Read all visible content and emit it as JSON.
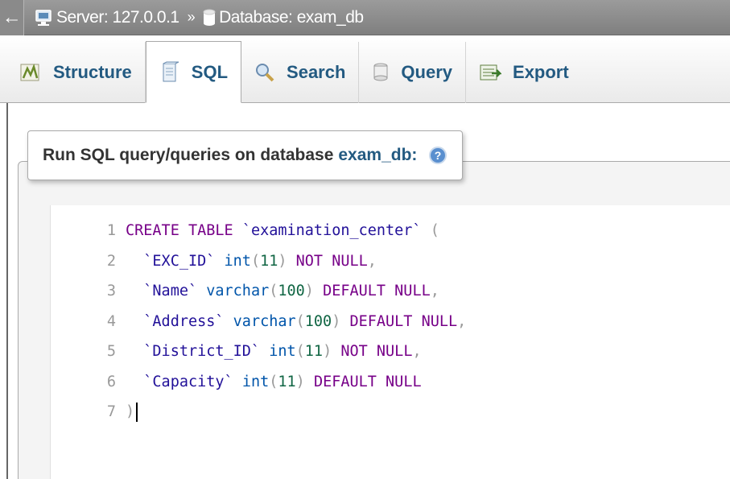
{
  "breadcrumb": {
    "server_label": "Server: 127.0.0.1",
    "separator": "»",
    "database_label": "Database: exam_db",
    "back_icon": "back-arrow-icon"
  },
  "tabs": [
    {
      "label": "Structure",
      "icon": "structure-icon",
      "active": false
    },
    {
      "label": "SQL",
      "icon": "sql-icon",
      "active": true
    },
    {
      "label": "Search",
      "icon": "search-icon",
      "active": false
    },
    {
      "label": "Query",
      "icon": "query-icon",
      "active": false
    },
    {
      "label": "Export",
      "icon": "export-icon",
      "active": false
    }
  ],
  "sql_panel": {
    "legend_prefix": "Run SQL query/queries on database",
    "legend_db": "exam_db:",
    "help_icon": "help-icon"
  },
  "editor": {
    "lines": [
      {
        "num": "1",
        "text": "CREATE TABLE `examination_center` ("
      },
      {
        "num": "2",
        "text": "  `EXC_ID` int(11) NOT NULL,"
      },
      {
        "num": "3",
        "text": "  `Name` varchar(100) DEFAULT NULL,"
      },
      {
        "num": "4",
        "text": "  `Address` varchar(100) DEFAULT NULL,"
      },
      {
        "num": "5",
        "text": "  `District_ID` int(11) NOT NULL,"
      },
      {
        "num": "6",
        "text": "  `Capacity` int(11) DEFAULT NULL"
      },
      {
        "num": "7",
        "text": ")"
      }
    ]
  },
  "colors": {
    "tab_text": "#235a81",
    "keyword": "#770088",
    "identifier": "#221199",
    "number": "#116644"
  }
}
